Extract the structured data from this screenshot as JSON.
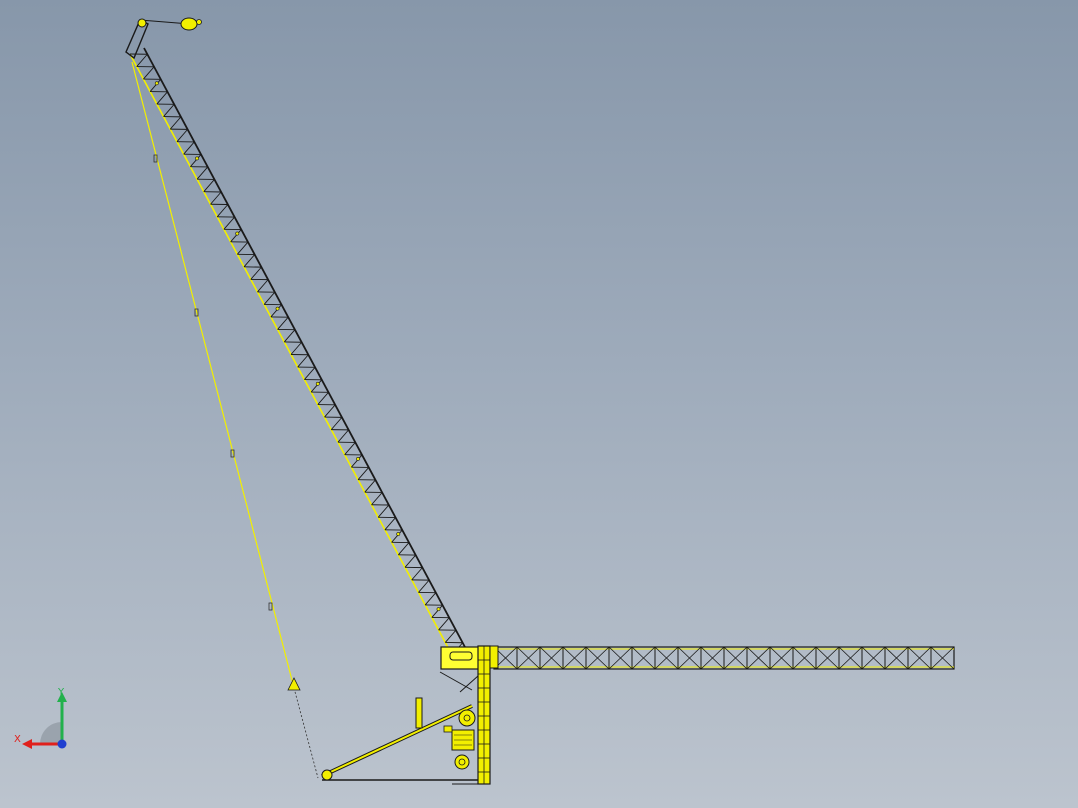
{
  "viewport": {
    "background_top": "#8797aa",
    "background_bottom": "#bcc4ce"
  },
  "model": {
    "colors": {
      "member_yellow": "#f2ef00",
      "member_dark": "#1a1a1a",
      "cab_fill": "#ffff33"
    }
  },
  "triad": {
    "x_label": "X",
    "y_label": "Y",
    "x_color": "#e0201c",
    "y_color": "#22b14c",
    "z_color": "#1f3fd0",
    "icon": "coordinate-triad-icon"
  }
}
